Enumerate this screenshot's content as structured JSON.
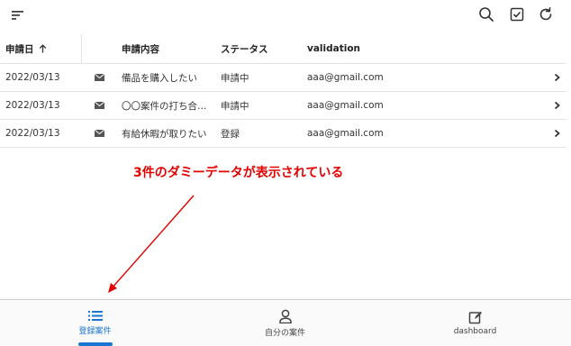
{
  "toolbar": {
    "menu_icon": "sort-lines-icon",
    "search_icon": "search-icon",
    "check_icon": "checkbox-icon",
    "refresh_icon": "refresh-icon"
  },
  "table": {
    "headers": {
      "date": "申請日",
      "content": "申請内容",
      "status": "ステータス",
      "validation": "validation"
    },
    "rows": [
      {
        "date": "2022/03/13",
        "content": "備品を購入したい",
        "status": "申請中",
        "email": "aaa@gmail.com"
      },
      {
        "date": "2022/03/13",
        "content": "〇〇案件の打ち合…",
        "status": "申請中",
        "email": "aaa@gmail.com"
      },
      {
        "date": "2022/03/13",
        "content": "有給休暇が取りたい",
        "status": "登録",
        "email": "aaa@gmail.com"
      }
    ]
  },
  "annotation": {
    "text": "3件のダミーデータが表示されている"
  },
  "bottom_nav": {
    "items": [
      {
        "label": "登録案件",
        "icon": "list-icon",
        "active": true
      },
      {
        "label": "自分の案件",
        "icon": "person-icon",
        "active": false
      },
      {
        "label": "dashboard",
        "icon": "edit-icon",
        "active": false
      }
    ]
  },
  "colors": {
    "accent": "#1976d2",
    "annotation": "#e30000"
  }
}
